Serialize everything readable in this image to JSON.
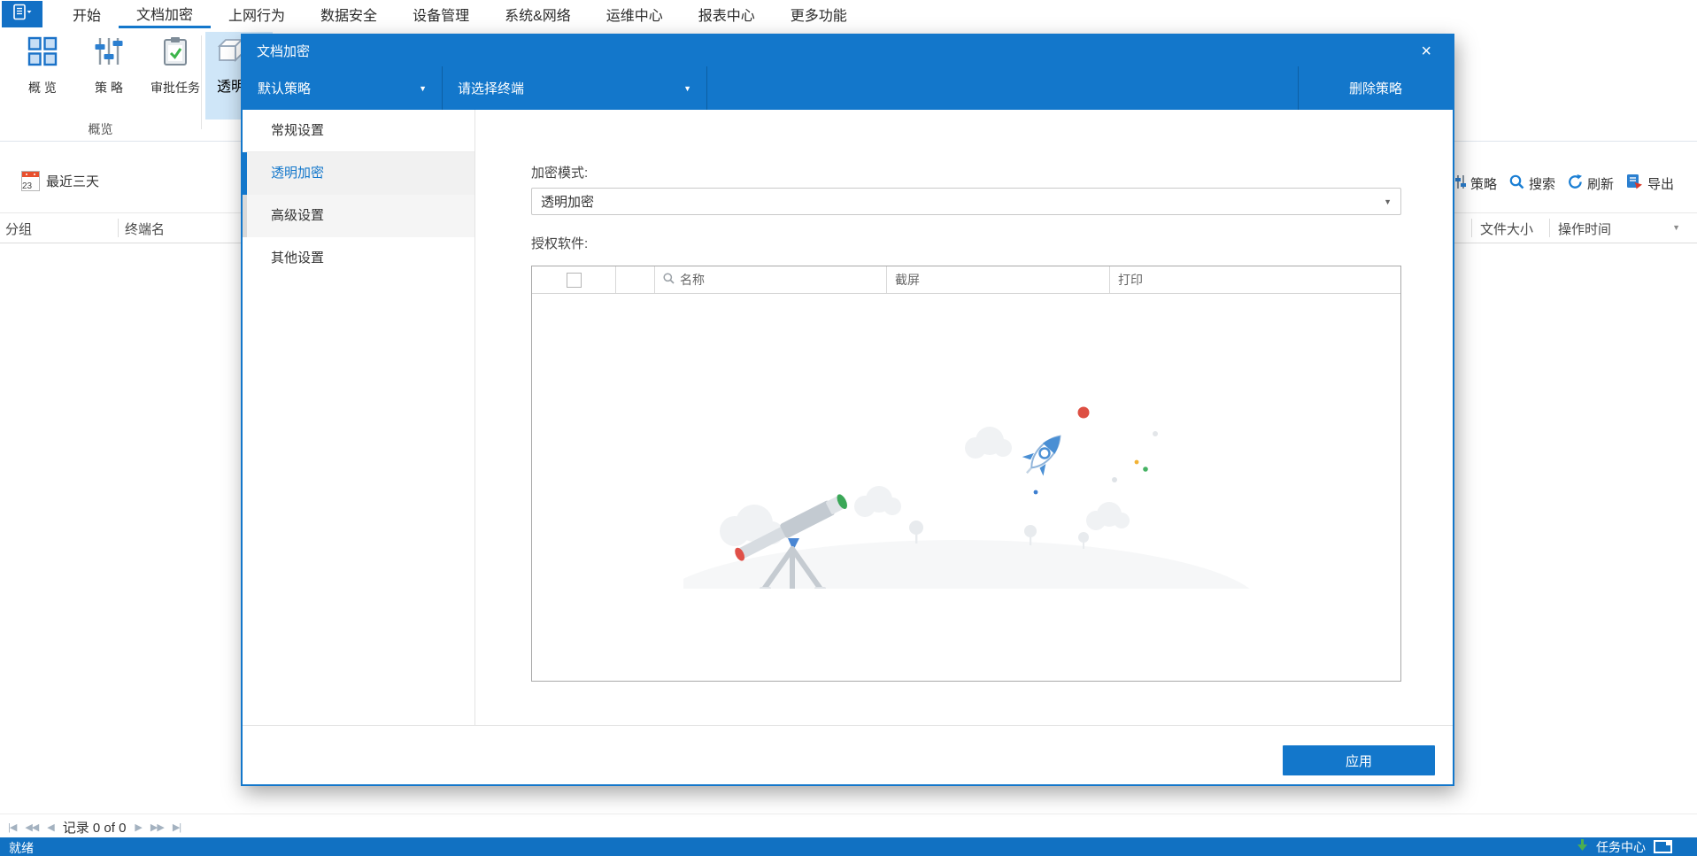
{
  "menu": {
    "items": [
      "开始",
      "文档加密",
      "上网行为",
      "数据安全",
      "设备管理",
      "系统&网络",
      "运维中心",
      "报表中心",
      "更多功能"
    ],
    "active": "文档加密"
  },
  "ribbon": {
    "buttons": [
      "概 览",
      "策 略",
      "审批任务"
    ],
    "partial_button": "透明",
    "group_label": "概览"
  },
  "filters": {
    "date_range": "最近三天",
    "calendar_day": "23"
  },
  "actions": {
    "policy": "策略",
    "search": "搜索",
    "refresh": "刷新",
    "export": "导出"
  },
  "bg_table": {
    "col_group": "分组",
    "col_terminal": "终端名",
    "col_filesize": "文件大小",
    "col_optime": "操作时间"
  },
  "pager": {
    "first": "|◀",
    "prev_fast": "◀◀",
    "prev": "◀",
    "record": "记录 0 of 0",
    "next": "▶",
    "next_fast": "▶▶",
    "last": "▶|"
  },
  "modal": {
    "title": "文档加密",
    "close": "×",
    "toolbar": {
      "policy_selector": "默认策略",
      "terminal_selector": "请选择终端",
      "delete_policy": "删除策略"
    },
    "nav": {
      "items": [
        "常规设置",
        "透明加密",
        "高级设置",
        "其他设置"
      ],
      "active": "透明加密"
    },
    "form": {
      "mode_label": "加密模式:",
      "mode_value": "透明加密",
      "authorized_label": "授权软件:"
    },
    "table": {
      "col_name": "名称",
      "col_screenshot": "截屏",
      "col_print": "打印"
    },
    "apply": "应用"
  },
  "statusbar": {
    "ready": "就绪",
    "task_center": "任务中心"
  },
  "colors": {
    "primary": "#1377cb",
    "primary_dark": "#0d5fa3",
    "statusbar_bg": "#1171c2",
    "ribbon_highlight": "#cfe6f8",
    "accent_red": "#dd4f43",
    "accent_green": "#3cb54a"
  }
}
